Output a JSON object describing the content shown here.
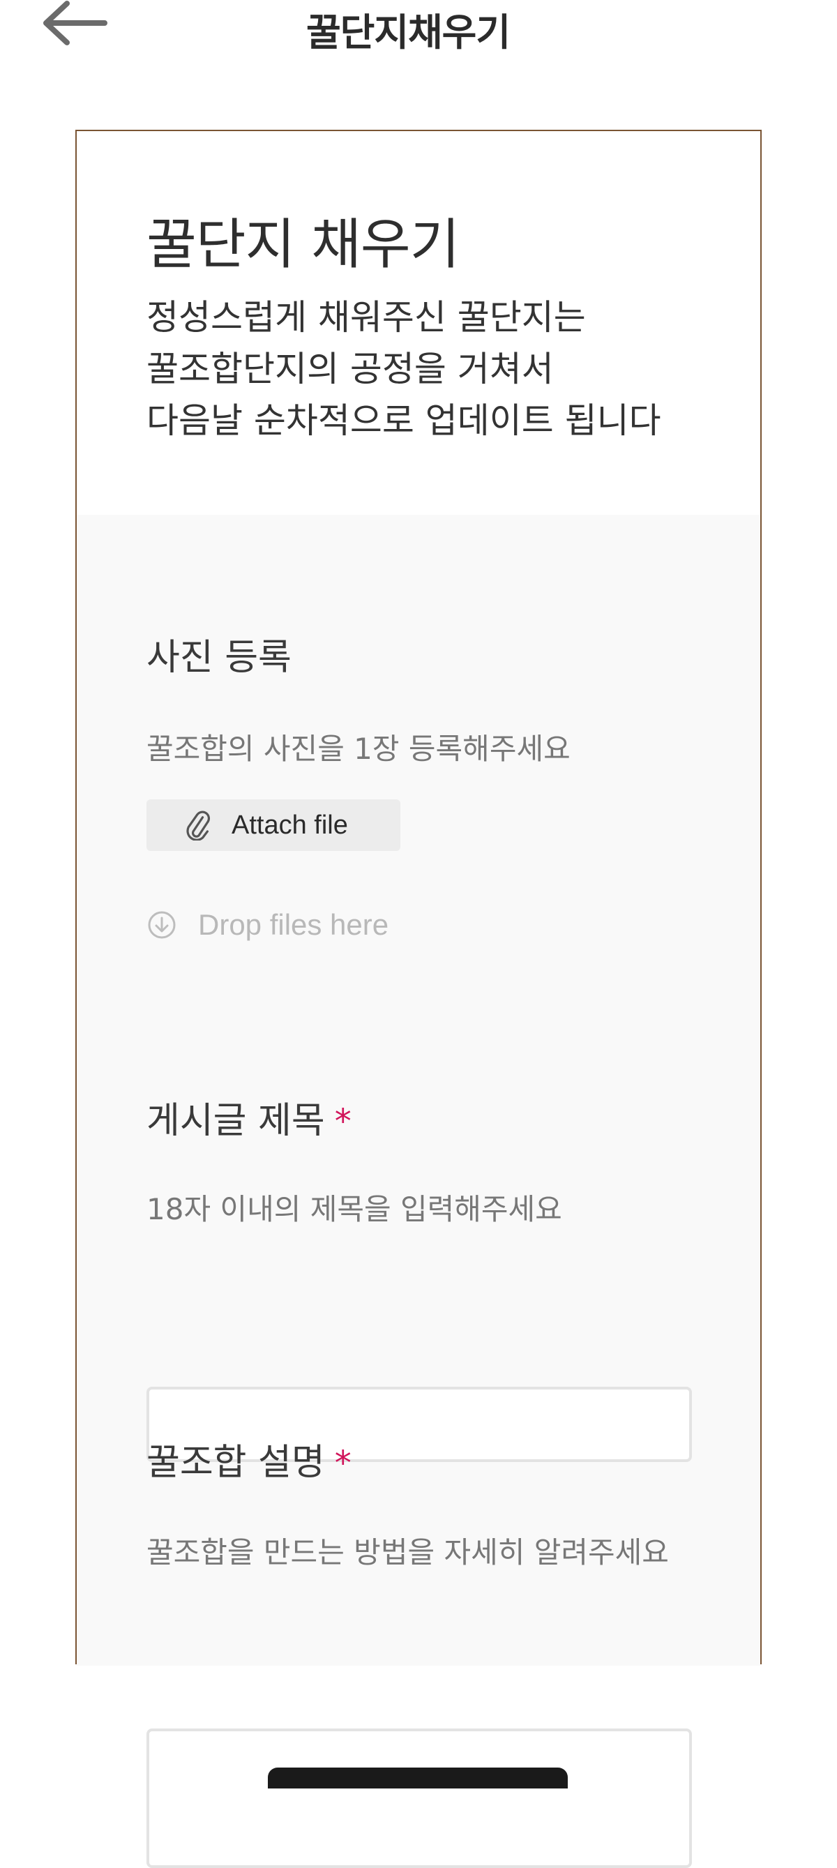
{
  "header": {
    "title": "꿀단지채우기",
    "back_icon": "arrow-left-icon"
  },
  "intro": {
    "title": "꿀단지 채우기",
    "description_lines": [
      "정성스럽게 채워주신 꿀단지는",
      "꿀조합단지의 공정을 거쳐서",
      "다음날 순차적으로 업데이트 됩니다"
    ]
  },
  "photo_section": {
    "label": "사진 등록",
    "help": "꿀조합의 사진을 1장 등록해주세요",
    "attach_label": "Attach file",
    "attach_icon": "paperclip-icon",
    "drop_label": "Drop files here",
    "drop_icon": "download-circle-icon"
  },
  "title_section": {
    "label": "게시글 제목",
    "required": "*",
    "help": "18자 이내의 제목을 입력해주세요",
    "value": ""
  },
  "desc_section": {
    "label": "꿀조합 설명",
    "required": "*",
    "help": "꿀조합을 만드는 방법을 자세히 알려주세요",
    "value": ""
  },
  "colors": {
    "card_border": "#7a5433",
    "required": "#d1145a",
    "form_bg": "#f9f9f9"
  }
}
